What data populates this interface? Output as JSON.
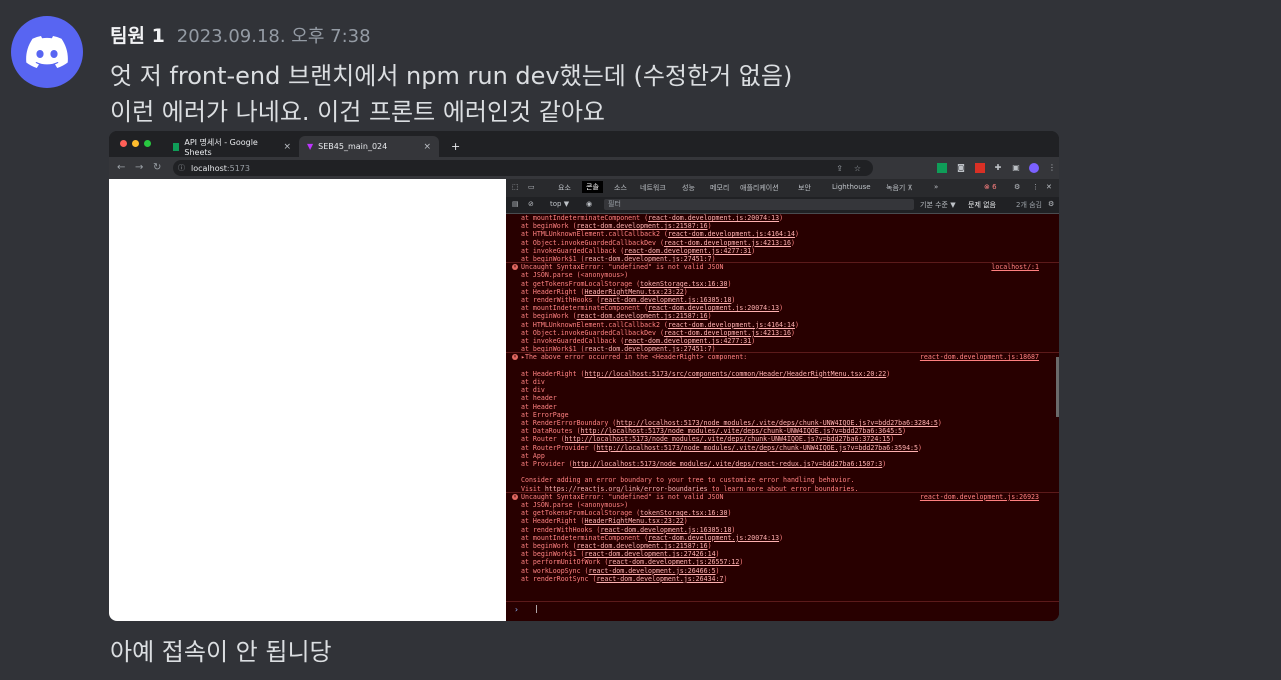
{
  "message": {
    "username": "팀원 1",
    "timestamp": "2023.09.18. 오후 7:38",
    "line1": "엇 저 front-end 브랜치에서 npm run dev했는데 (수정한거 없음)",
    "line2": "이런 에러가 나네요. 이건 프론트 에러인것 같아요",
    "line3": "아예 접속이 안 됩니당"
  },
  "browser": {
    "tabs": [
      {
        "label": "API 명세서 - Google Sheets",
        "close": "×"
      },
      {
        "label": "SEB45_main_024",
        "close": "×"
      }
    ],
    "new_tab": "+",
    "url_host": "localhost",
    "url_port": ":5173"
  },
  "devtools": {
    "tabs": [
      "요소",
      "콘솔",
      "소스",
      "네트워크",
      "성능",
      "메모리",
      "애플리케이션",
      "보안",
      "Lighthouse",
      "녹음기 ⊼",
      "»"
    ],
    "error_count": "6",
    "context": "top ▼",
    "filter_placeholder": "필터",
    "levels": "기본 수준 ▼",
    "issues": "문제 없음",
    "hidden": "2개 숨김",
    "prompt": "›"
  },
  "console": [
    {
      "text": "    at mountIndeterminateComponent (",
      "link": "react-dom.development.js:20074:13",
      "tail": ")"
    },
    {
      "text": "    at beginWork (",
      "link": "react-dom.development.js:21587:16",
      "tail": ")"
    },
    {
      "text": "    at HTMLUnknownElement.callCallback2 (",
      "link": "react-dom.development.js:4164:14",
      "tail": ")"
    },
    {
      "text": "    at Object.invokeGuardedCallbackDev (",
      "link": "react-dom.development.js:4213:16",
      "tail": ")"
    },
    {
      "text": "    at invokeGuardedCallback (",
      "link": "react-dom.development.js:4277:31",
      "tail": ")"
    },
    {
      "text": "    at beginWork$1 (",
      "link": "react-dom.development.js:27451:7",
      "tail": ")"
    },
    {
      "text": "Uncaught SyntaxError: \"undefined\" is not valid JSON",
      "src": "localhost/:1",
      "err": true
    },
    {
      "text": "    at JSON.parse (<anonymous>)"
    },
    {
      "text": "    at getTokensFromLocalStorage (",
      "link": "tokenStorage.tsx:16:30",
      "tail": ")"
    },
    {
      "text": "    at HeaderRight (",
      "link": "HeaderRightMenu.tsx:23:22",
      "tail": ")"
    },
    {
      "text": "    at renderWithHooks (",
      "link": "react-dom.development.js:16305:18",
      "tail": ")"
    },
    {
      "text": "    at mountIndeterminateComponent (",
      "link": "react-dom.development.js:20074:13",
      "tail": ")"
    },
    {
      "text": "    at beginWork (",
      "link": "react-dom.development.js:21587:16",
      "tail": ")"
    },
    {
      "text": "    at HTMLUnknownElement.callCallback2 (",
      "link": "react-dom.development.js:4164:14",
      "tail": ")"
    },
    {
      "text": "    at Object.invokeGuardedCallbackDev (",
      "link": "react-dom.development.js:4213:16",
      "tail": ")"
    },
    {
      "text": "    at invokeGuardedCallback (",
      "link": "react-dom.development.js:4277:31",
      "tail": ")"
    },
    {
      "text": "    at beginWork$1 (",
      "link": "react-dom.development.js:27451:7",
      "tail": ")"
    },
    {
      "text": "▸The above error occurred in the <HeaderRight> component:",
      "src": "react-dom.development.js:18687",
      "err": true
    },
    {
      "text": ""
    },
    {
      "text": "    at HeaderRight (",
      "link": "http://localhost:5173/src/components/common/Header/HeaderRightMenu.tsx:20:22",
      "tail": ")"
    },
    {
      "text": "    at div"
    },
    {
      "text": "    at div"
    },
    {
      "text": "    at header"
    },
    {
      "text": "    at Header"
    },
    {
      "text": "    at ErrorPage"
    },
    {
      "text": "    at RenderErrorBoundary (",
      "link": "http://localhost:5173/node_modules/.vite/deps/chunk-UNW4IQOE.js?v=bdd27ba6:3284:5",
      "tail": ")"
    },
    {
      "text": "    at DataRoutes (",
      "link": "http://localhost:5173/node_modules/.vite/deps/chunk-UNW4IQOE.js?v=bdd27ba6:3645:5",
      "tail": ")"
    },
    {
      "text": "    at Router (",
      "link": "http://localhost:5173/node_modules/.vite/deps/chunk-UNW4IQOE.js?v=bdd27ba6:3724:15",
      "tail": ")"
    },
    {
      "text": "    at RouterProvider (",
      "link": "http://localhost:5173/node_modules/.vite/deps/chunk-UNW4IQOE.js?v=bdd27ba6:3594:5",
      "tail": ")"
    },
    {
      "text": "    at App"
    },
    {
      "text": "    at Provider (",
      "link": "http://localhost:5173/node_modules/.vite/deps/react-redux.js?v=bdd27ba6:1507:3",
      "tail": ")"
    },
    {
      "text": ""
    },
    {
      "text": "Consider adding an error boundary to your tree to customize error handling behavior."
    },
    {
      "text": "Visit ",
      "link": "https://reactjs.org/link/error-boundaries",
      "tail": " to learn more about error boundaries."
    },
    {
      "text": "Uncaught SyntaxError: \"undefined\" is not valid JSON",
      "src": "react-dom.development.js:26923",
      "err": true
    },
    {
      "text": "    at JSON.parse (<anonymous>)"
    },
    {
      "text": "    at getTokensFromLocalStorage (",
      "link": "tokenStorage.tsx:16:30",
      "tail": ")"
    },
    {
      "text": "    at HeaderRight (",
      "link": "HeaderRightMenu.tsx:23:22",
      "tail": ")"
    },
    {
      "text": "    at renderWithHooks (",
      "link": "react-dom.development.js:16305:18",
      "tail": ")"
    },
    {
      "text": "    at mountIndeterminateComponent (",
      "link": "react-dom.development.js:20074:13",
      "tail": ")"
    },
    {
      "text": "    at beginWork (",
      "link": "react-dom.development.js:21587:16",
      "tail": ")"
    },
    {
      "text": "    at beginWork$1 (",
      "link": "react-dom.development.js:27426:14",
      "tail": ")"
    },
    {
      "text": "    at performUnitOfWork (",
      "link": "react-dom.development.js:26557:12",
      "tail": ")"
    },
    {
      "text": "    at workLoopSync (",
      "link": "react-dom.development.js:26466:5",
      "tail": ")"
    },
    {
      "text": "    at renderRootSync (",
      "link": "react-dom.development.js:26434:7",
      "tail": ")"
    }
  ]
}
